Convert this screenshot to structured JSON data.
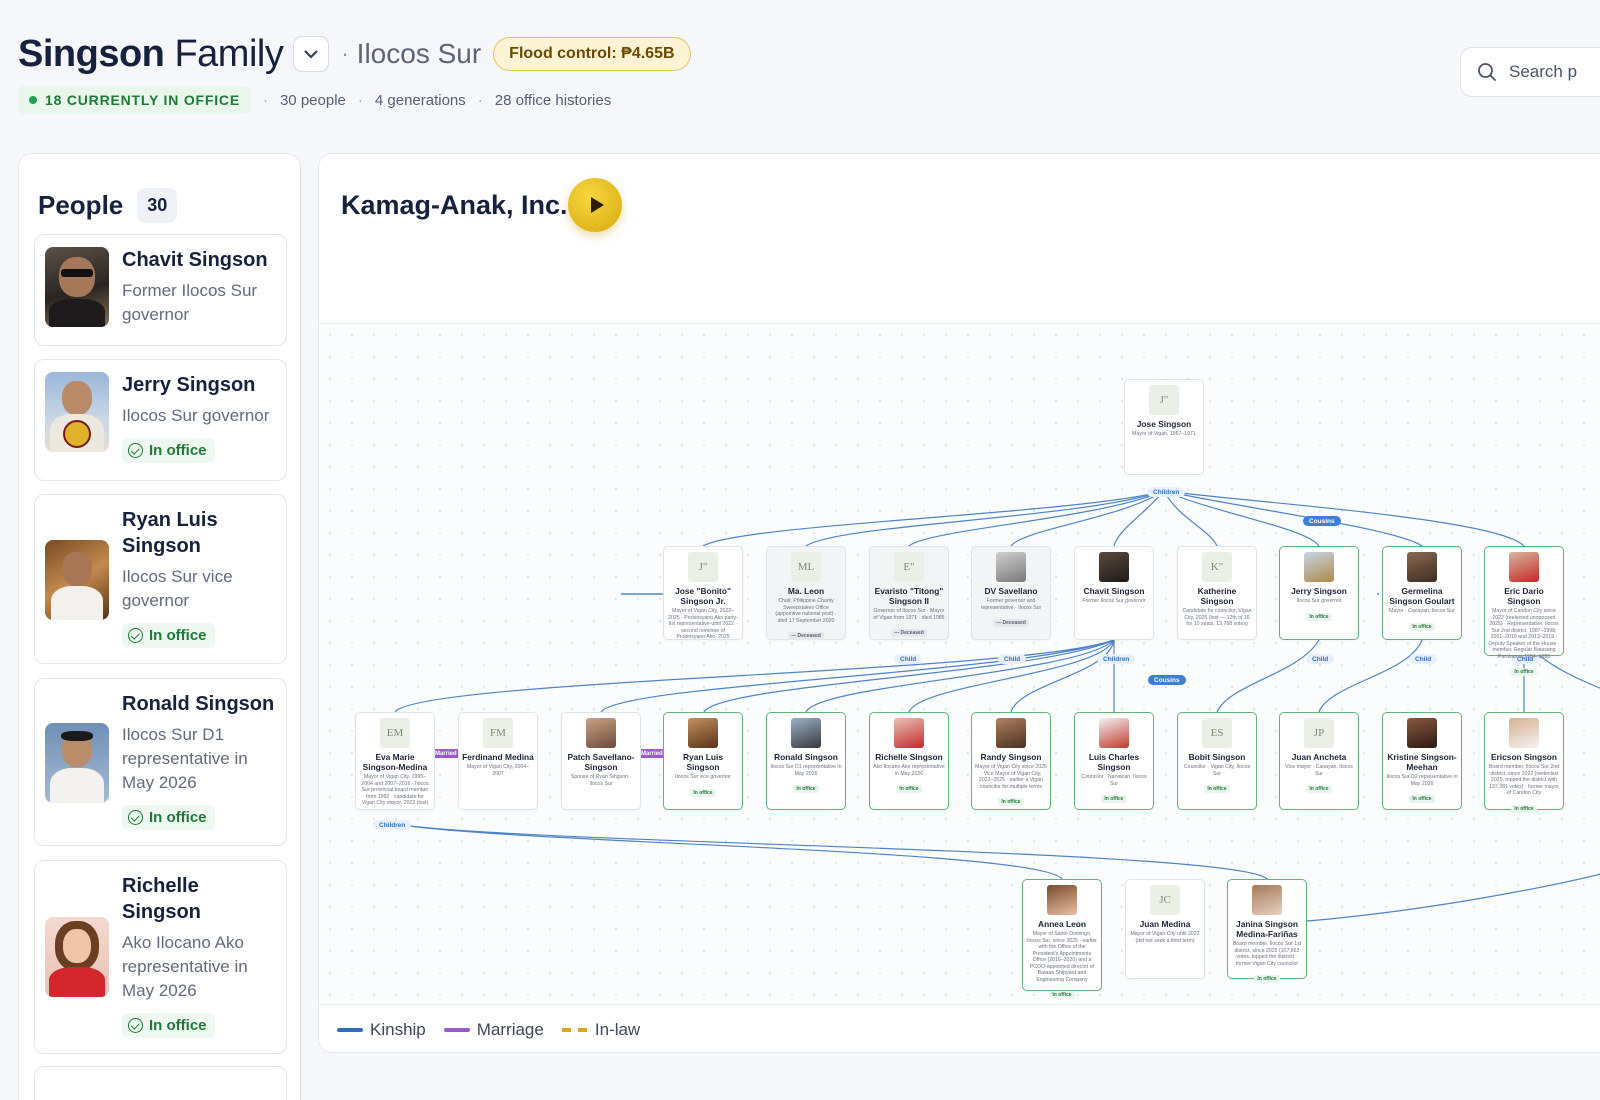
{
  "header": {
    "family_name": "Singson",
    "family_word": "Family",
    "province": "Ilocos Sur",
    "flood_control": "Flood control: ₱4.65B",
    "in_office": "18 CURRENTLY IN OFFICE",
    "people_count": "30 people",
    "generations": "4 generations",
    "office_histories": "28 office histories",
    "search_placeholder": "Search p"
  },
  "sidebar": {
    "title": "People",
    "count": "30",
    "people": [
      {
        "name": "Chavit Singson",
        "role": "Former Ilocos Sur governor",
        "status": ""
      },
      {
        "name": "Jerry Singson",
        "role": "Ilocos Sur governor",
        "status": "In office"
      },
      {
        "name": "Ryan Luis Singson",
        "role": "Ilocos Sur vice governor",
        "status": "In office"
      },
      {
        "name": "Ronald Singson",
        "role": "Ilocos Sur D1 representative in May 2026",
        "status": "In office"
      },
      {
        "name": "Richelle Singson",
        "role": "Ako Ilocano Ako representative in May 2026",
        "status": "In office"
      }
    ]
  },
  "panel": {
    "title": "Kamag-Anak, Inc.",
    "legend": [
      "Kinship",
      "Marriage",
      "In-law"
    ]
  },
  "tree": {
    "labels": {
      "children": "Children",
      "cousins": "Cousins",
      "child": "Child",
      "married": "Married"
    },
    "gen1": [
      {
        "initials": "J\"",
        "name": "Jose Singson",
        "desc": "Mayor of Vigan, 1967–1971",
        "status": ""
      }
    ],
    "gen2": [
      {
        "initials": "J\"",
        "name": "Jose \"Bonito\" Singson Jr.",
        "desc": "Mayor of Vigan City, 2022–2025 · Probinsyano Ako party-list representative-until 2022 · second nominee of Probinsyano Ako, 2025",
        "status": ""
      },
      {
        "initials": "ML",
        "name": "Ma. Leon",
        "desc": "Chair, Philippine Charity Sweepstakes Office (appointive national post) · died 17 September 2020",
        "status": "— Deceased"
      },
      {
        "initials": "E\"",
        "name": "Evaristo \"Titong\" Singson II",
        "desc": "Governor of Ilocos Sur · Mayor of Vigan from 1971 · died 1986",
        "status": "— Deceased"
      },
      {
        "initials": "",
        "name": "DV Savellano",
        "desc": "Former governor and representative · Ilocos Sur",
        "status": "— Deceased"
      },
      {
        "initials": "",
        "name": "Chavit Singson",
        "desc": "Former Ilocos Sur governor",
        "status": ""
      },
      {
        "initials": "K\"",
        "name": "Katherine Singson",
        "desc": "Candidate for councilor, Vigan City, 2025 (lost — 12th of 16 for 10 seats, 13,768 votes)",
        "status": ""
      },
      {
        "initials": "",
        "name": "Jerry Singson",
        "desc": "Ilocos Sur governor",
        "status": "In office"
      },
      {
        "initials": "",
        "name": "Germelina Singson Goulart",
        "desc": "Mayor · Caoayan, Ilocos Sur",
        "status": "In office"
      },
      {
        "initials": "",
        "name": "Eric Dario Singson",
        "desc": "Mayor of Candon City since 2022 (reelected unopposed 2025) · Representative, Ilocos Sur 2nd district, 1987–1998, 2001–2010 and 2013–2019 · Deputy Speaker of the House · member, Regular Batasang Pambansa 1984–1986",
        "status": "In office"
      }
    ],
    "gen3": [
      {
        "initials": "EM",
        "name": "Eva Marie Singson-Medina",
        "desc": "Mayor of Vigan City, 1995–2004 and 2007–2016 · Ilocos Sur provincial board member from 1992 · candidate for Vigan City mayor, 2022 (lost)",
        "status": ""
      },
      {
        "initials": "FM",
        "name": "Ferdinand Medina",
        "desc": "Mayor of Vigan City, 2004–2007",
        "status": ""
      },
      {
        "initials": "",
        "name": "Patch Savellano-Singson",
        "desc": "Spouse of Ryan Singson · Ilocos Sur",
        "status": ""
      },
      {
        "initials": "",
        "name": "Ryan Luis Singson",
        "desc": "Ilocos Sur vice governor",
        "status": "In office"
      },
      {
        "initials": "",
        "name": "Ronald Singson",
        "desc": "Ilocos Sur D1 representative in May 2026",
        "status": "In office"
      },
      {
        "initials": "",
        "name": "Richelle Singson",
        "desc": "Ako Ilocano Ako representative in May 2026",
        "status": "In office"
      },
      {
        "initials": "",
        "name": "Randy Singson",
        "desc": "Mayor of Vigan City since 2025 · Vice Mayor of Vigan City, 2022–2025 · earlier a Vigan councilor for multiple terms",
        "status": "In office"
      },
      {
        "initials": "",
        "name": "Luis Charles Singson",
        "desc": "Councilor · Narvacan, Ilocos Sur",
        "status": "In office"
      },
      {
        "initials": "ES",
        "name": "Bobit Singson",
        "desc": "Councilor · Vigan City, Ilocos Sur",
        "status": "In office"
      },
      {
        "initials": "JP",
        "name": "Juan Ancheta",
        "desc": "Vice mayor · Caoayan, Ilocos Sur",
        "status": "In office"
      },
      {
        "initials": "",
        "name": "Kristine Singson-Meehan",
        "desc": "Ilocos Sur D2 representative in May 2026",
        "status": "In office"
      },
      {
        "initials": "",
        "name": "Ericson Singson",
        "desc": "Board member, Ilocos Sur 2nd district, since 2022 (reelected 2025, topped the district with 137,381 votes) · former mayor of Candon City",
        "status": "In office"
      }
    ],
    "gen4": [
      {
        "initials": "",
        "name": "Annea Leon",
        "desc": "Mayor of Santo Domingo, Ilocos Sur, since 2025 · earlier with the Office of the President's Appointments Office (2016–2020) and a PCOO-appointed director of Bataan Shipyard and Engineering Company",
        "status": "In office"
      },
      {
        "initials": "JC",
        "name": "Juan Medina",
        "desc": "Mayor of Vigan City until 2022 (did not seek a third term)",
        "status": ""
      },
      {
        "initials": "",
        "name": "Janina Singson Medina-Fariñas",
        "desc": "Board member, Ilocos Sur 1st district, since 2025 (107,663 votes, topped the district) · former Vigan City councilor",
        "status": "In office"
      }
    ]
  },
  "colors": {
    "kinship": "#2f6fc2",
    "marriage": "#9b59c9",
    "inlaw": "#d8a412",
    "office_green": "#1f7a3a",
    "accent_gold": "#e2b52a"
  }
}
